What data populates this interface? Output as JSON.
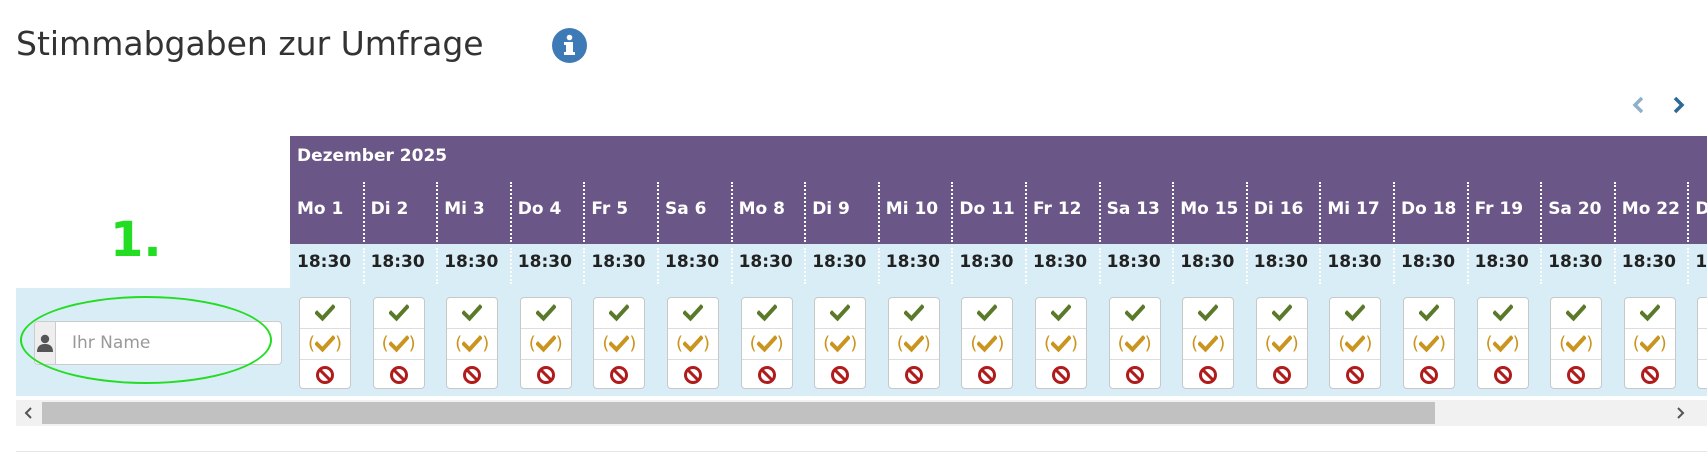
{
  "page_title": "Stimmabgaben zur Umfrage",
  "annotation_number": "1.",
  "month": "Dezember 2025",
  "name_input": {
    "placeholder": "Ihr Name",
    "value": ""
  },
  "days": [
    {
      "label": "Mo 1",
      "time": "18:30"
    },
    {
      "label": "Di 2",
      "time": "18:30"
    },
    {
      "label": "Mi 3",
      "time": "18:30"
    },
    {
      "label": "Do 4",
      "time": "18:30"
    },
    {
      "label": "Fr 5",
      "time": "18:30"
    },
    {
      "label": "Sa 6",
      "time": "18:30"
    },
    {
      "label": "Mo 8",
      "time": "18:30"
    },
    {
      "label": "Di 9",
      "time": "18:30"
    },
    {
      "label": "Mi 10",
      "time": "18:30"
    },
    {
      "label": "Do 11",
      "time": "18:30"
    },
    {
      "label": "Fr 12",
      "time": "18:30"
    },
    {
      "label": "Sa 13",
      "time": "18:30"
    },
    {
      "label": "Mo 15",
      "time": "18:30"
    },
    {
      "label": "Di 16",
      "time": "18:30"
    },
    {
      "label": "Mi 17",
      "time": "18:30"
    },
    {
      "label": "Do 18",
      "time": "18:30"
    },
    {
      "label": "Fr 19",
      "time": "18:30"
    },
    {
      "label": "Sa 20",
      "time": "18:30"
    },
    {
      "label": "Mo 22",
      "time": "18:30"
    },
    {
      "label": "D",
      "time": "1"
    }
  ],
  "vote_options": {
    "yes": {
      "icon": "check-icon",
      "color": "#5a7a2a"
    },
    "if_need_be": {
      "icon": "check-in-parentheses-icon",
      "color": "#c9951f"
    },
    "no": {
      "icon": "ban-icon",
      "color": "#b01c1c"
    }
  },
  "colors": {
    "header_purple": "#6b5787",
    "row_light_blue": "#d9edf7",
    "info_blue": "#3e7bb6",
    "annotation_green": "#22dd22"
  },
  "icons": {
    "info": "info-circle-icon",
    "prev": "chevron-left-icon",
    "next": "chevron-right-icon",
    "user": "user-icon"
  }
}
